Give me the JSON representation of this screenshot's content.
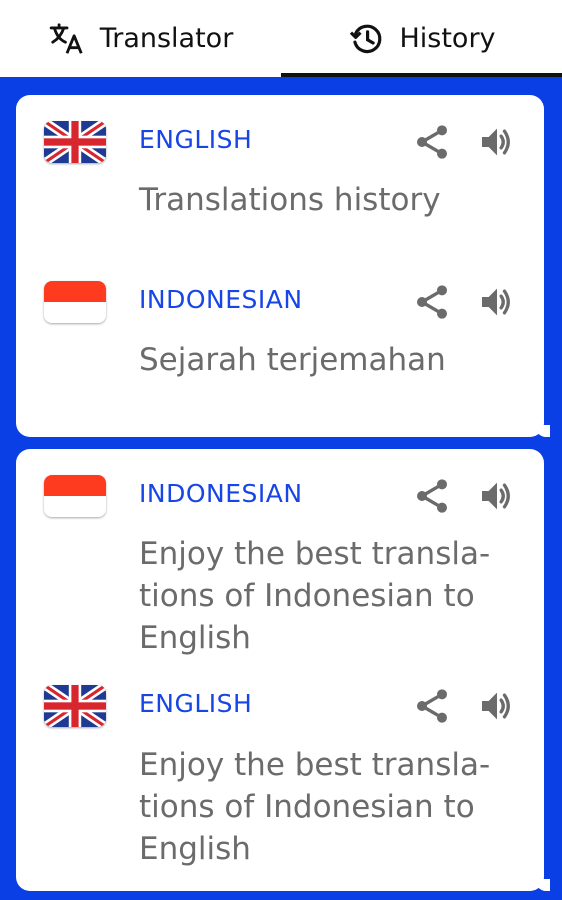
{
  "tabs": [
    {
      "label": "Translator",
      "icon": "translate-icon",
      "active": false
    },
    {
      "label": "History",
      "icon": "history-icon",
      "active": true
    }
  ],
  "colors": {
    "background": "#0b3fe6",
    "language": "#1745e6",
    "text": "#6b6b6b",
    "card": "#ffffff"
  },
  "history": [
    {
      "entries": [
        {
          "language": "ENGLISH",
          "flag": "uk-flag",
          "text": "Translations history"
        },
        {
          "language": "INDONESIAN",
          "flag": "indonesia-flag",
          "text": "Sejarah terjemahan"
        }
      ]
    },
    {
      "entries": [
        {
          "language": "INDONESIAN",
          "flag": "indonesia-flag",
          "text": "Enjoy the best transla-tions of Indonesian to English"
        },
        {
          "language": "ENGLISH",
          "flag": "uk-flag",
          "text": "Enjoy the best transla-tions of Indonesian to English"
        }
      ]
    }
  ]
}
